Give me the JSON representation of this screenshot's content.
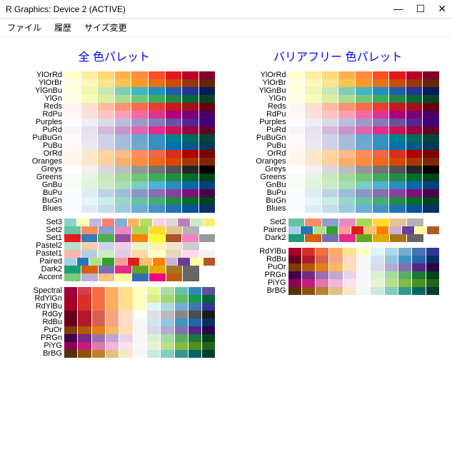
{
  "window": {
    "title": "R Graphics: Device 2 (ACTIVE)"
  },
  "menu": [
    "ファイル",
    "履歴",
    "サイズ変更"
  ],
  "chart_data": {
    "type": "table",
    "left_title": "全 色パレット",
    "right_title": "バリアフリー 色パレット",
    "palettes": {
      "YlOrRd": [
        "#FFFFCC",
        "#FFEDA0",
        "#FED976",
        "#FEB24C",
        "#FD8D3C",
        "#FC4E2A",
        "#E31A1C",
        "#BD0026",
        "#800026"
      ],
      "YlOrBr": [
        "#FFFFE5",
        "#FFF7BC",
        "#FEE391",
        "#FEC44F",
        "#FE9929",
        "#EC7014",
        "#CC4C02",
        "#993404",
        "#662506"
      ],
      "YlGnBu": [
        "#FFFFD9",
        "#EDF8B1",
        "#C7E9B4",
        "#7FCDBB",
        "#41B6C4",
        "#1D91C0",
        "#225EA8",
        "#253494",
        "#081D58"
      ],
      "YlGn": [
        "#FFFFE5",
        "#F7FCB9",
        "#D9F0A3",
        "#ADDD8E",
        "#78C679",
        "#41AB5D",
        "#238443",
        "#006837",
        "#004529"
      ],
      "Reds": [
        "#FFF5F0",
        "#FEE0D2",
        "#FCBBA1",
        "#FC9272",
        "#FB6A4A",
        "#EF3B2C",
        "#CB181D",
        "#A50F15",
        "#67000D"
      ],
      "RdPu": [
        "#FFF7F3",
        "#FDE0DD",
        "#FCC5C0",
        "#FA9FB5",
        "#F768A1",
        "#DD3497",
        "#AE017E",
        "#7A0177",
        "#49006A"
      ],
      "Purples": [
        "#FCFBFD",
        "#EFEDF5",
        "#DADAEB",
        "#BCBDDC",
        "#9E9AC8",
        "#807DBA",
        "#6A51A3",
        "#54278F",
        "#3F007D"
      ],
      "PuRd": [
        "#F7F4F9",
        "#E7E1EF",
        "#D4B9DA",
        "#C994C7",
        "#DF65B0",
        "#E7298A",
        "#CE1256",
        "#980043",
        "#67001F"
      ],
      "PuBuGn": [
        "#FFF7FB",
        "#ECE2F0",
        "#D0D1E6",
        "#A6BDDB",
        "#67A9CF",
        "#3690C0",
        "#02818A",
        "#016C59",
        "#014636"
      ],
      "PuBu": [
        "#FFF7FB",
        "#ECE7F2",
        "#D0D1E6",
        "#A6BDDB",
        "#74A9CF",
        "#3690C0",
        "#0570B0",
        "#045A8D",
        "#023858"
      ],
      "OrRd": [
        "#FFF7EC",
        "#FEE8C8",
        "#FDD49E",
        "#FDBB84",
        "#FC8D59",
        "#EF6548",
        "#D7301F",
        "#B30000",
        "#7F0000"
      ],
      "Oranges": [
        "#FFF5EB",
        "#FEE6CE",
        "#FDD0A2",
        "#FDAE6B",
        "#FD8D3C",
        "#F16913",
        "#D94801",
        "#A63603",
        "#7F2704"
      ],
      "Greys": [
        "#FFFFFF",
        "#F0F0F0",
        "#D9D9D9",
        "#BDBDBD",
        "#969696",
        "#737373",
        "#525252",
        "#252525",
        "#000000"
      ],
      "Greens": [
        "#F7FCF5",
        "#E5F5E0",
        "#C7E9C0",
        "#A1D99B",
        "#74C476",
        "#41AB5D",
        "#238B45",
        "#006D2C",
        "#00441B"
      ],
      "GnBu": [
        "#F7FCF0",
        "#E0F3DB",
        "#CCEBC5",
        "#A8DDB5",
        "#7BCCC4",
        "#4EB3D3",
        "#2B8CBE",
        "#0868AC",
        "#084081"
      ],
      "BuPu": [
        "#F7FCFD",
        "#E0ECF4",
        "#BFD3E6",
        "#9EBCDA",
        "#8C96C6",
        "#8C6BB1",
        "#88419D",
        "#810F7C",
        "#4D004B"
      ],
      "BuGn": [
        "#F7FCFD",
        "#E5F5F9",
        "#CCECE6",
        "#99D8C9",
        "#66C2A4",
        "#41AE76",
        "#238B45",
        "#006D2C",
        "#00441B"
      ],
      "Blues": [
        "#F7FBFF",
        "#DEEBF7",
        "#C6DBEF",
        "#9ECAE1",
        "#6BAED6",
        "#4292C6",
        "#2171B5",
        "#08519C",
        "#08306B"
      ],
      "Set3": [
        "#8DD3C7",
        "#FFFFB3",
        "#BEBADA",
        "#FB8072",
        "#80B1D3",
        "#FDB462",
        "#B3DE69",
        "#FCCDE5",
        "#D9D9D9",
        "#BC80BD",
        "#CCEBC5",
        "#FFED6F"
      ],
      "Set2": [
        "#66C2A5",
        "#FC8D62",
        "#8DA0CB",
        "#E78AC3",
        "#A6D854",
        "#FFD92F",
        "#E5C494",
        "#B3B3B3"
      ],
      "Set1": [
        "#E41A1C",
        "#377EB8",
        "#4DAF4A",
        "#984EA3",
        "#FF7F00",
        "#FFFF33",
        "#A65628",
        "#F781BF",
        "#999999"
      ],
      "Pastel2": [
        "#B3E2CD",
        "#FDCDAC",
        "#CBD5E8",
        "#F4CAE4",
        "#E6F5C9",
        "#FFF2AE",
        "#F1E2CC",
        "#CCCCCC"
      ],
      "Pastel1": [
        "#FBB4AE",
        "#B3CDE3",
        "#CCEBC5",
        "#DECBE4",
        "#FED9A6",
        "#FFFFCC",
        "#E5D8BD",
        "#FDDAEC",
        "#F2F2F2"
      ],
      "Paired": [
        "#A6CEE3",
        "#1F78B4",
        "#B2DF8A",
        "#33A02C",
        "#FB9A99",
        "#E31A1C",
        "#FDBF6F",
        "#FF7F00",
        "#CAB2D6",
        "#6A3D9A",
        "#FFFF99",
        "#B15928"
      ],
      "Dark2": [
        "#1B9E77",
        "#D95F02",
        "#7570B3",
        "#E7298A",
        "#66A61E",
        "#E6AB02",
        "#A6761D",
        "#666666"
      ],
      "Accent": [
        "#7FC97F",
        "#BEAED4",
        "#FDC086",
        "#FFFF99",
        "#386CB0",
        "#F0027F",
        "#BF5B17",
        "#666666"
      ],
      "Spectral": [
        "#9E0142",
        "#D53E4F",
        "#F46D43",
        "#FDAE61",
        "#FEE08B",
        "#FFFFBF",
        "#E6F598",
        "#ABDDA4",
        "#66C2A5",
        "#3288BD",
        "#5E4FA2"
      ],
      "RdYlGn": [
        "#A50026",
        "#D73027",
        "#F46D43",
        "#FDAE61",
        "#FEE08B",
        "#FFFFBF",
        "#D9EF8B",
        "#A6D96A",
        "#66BD63",
        "#1A9850",
        "#006837"
      ],
      "RdYlBu": [
        "#A50026",
        "#D73027",
        "#F46D43",
        "#FDAE61",
        "#FEE090",
        "#FFFFBF",
        "#E0F3F8",
        "#ABD9E9",
        "#74ADD1",
        "#4575B4",
        "#313695"
      ],
      "RdGy": [
        "#67001F",
        "#B2182B",
        "#D6604D",
        "#F4A582",
        "#FDDBC7",
        "#FFFFFF",
        "#E0E0E0",
        "#BABABA",
        "#878787",
        "#4D4D4D",
        "#1A1A1A"
      ],
      "RdBu": [
        "#67001F",
        "#B2182B",
        "#D6604D",
        "#F4A582",
        "#FDDBC7",
        "#F7F7F7",
        "#D1E5F0",
        "#92C5DE",
        "#4393C3",
        "#2166AC",
        "#053061"
      ],
      "PuOr": [
        "#7F3B08",
        "#B35806",
        "#E08214",
        "#FDB863",
        "#FEE0B6",
        "#F7F7F7",
        "#D8DAEB",
        "#B2ABD2",
        "#8073AC",
        "#542788",
        "#2D004B"
      ],
      "PRGn": [
        "#40004B",
        "#762A83",
        "#9970AB",
        "#C2A5CF",
        "#E7D4E8",
        "#F7F7F7",
        "#D9F0D3",
        "#A6DBA0",
        "#5AAE61",
        "#1B7837",
        "#00441B"
      ],
      "PiYG": [
        "#8E0152",
        "#C51B7D",
        "#DE77AE",
        "#F1B6DA",
        "#FDE0EF",
        "#F7F7F7",
        "#E6F5D0",
        "#B8E186",
        "#7FBC41",
        "#4D9221",
        "#276419"
      ],
      "BrBG": [
        "#543005",
        "#8C510A",
        "#BF812D",
        "#DFC27D",
        "#F6E8C3",
        "#F5F5F5",
        "#C7EAE5",
        "#80CDC1",
        "#35978F",
        "#01665E",
        "#003C30"
      ]
    },
    "left_groups": [
      [
        "YlOrRd",
        "YlOrBr",
        "YlGnBu",
        "YlGn",
        "Reds",
        "RdPu",
        "Purples",
        "PuRd",
        "PuBuGn",
        "PuBu",
        "OrRd",
        "Oranges",
        "Greys",
        "Greens",
        "GnBu",
        "BuPu",
        "BuGn",
        "Blues"
      ],
      [
        "Set3",
        "Set2",
        "Set1",
        "Pastel2",
        "Pastel1",
        "Paired",
        "Dark2",
        "Accent"
      ],
      [
        "Spectral",
        "RdYlGn",
        "RdYlBu",
        "RdGy",
        "RdBu",
        "PuOr",
        "PRGn",
        "PiYG",
        "BrBG"
      ]
    ],
    "right_groups": [
      [
        "YlOrRd",
        "YlOrBr",
        "YlGnBu",
        "YlGn",
        "Reds",
        "RdPu",
        "Purples",
        "PuRd",
        "PuBuGn",
        "PuBu",
        "OrRd",
        "Oranges",
        "Greys",
        "Greens",
        "GnBu",
        "BuPu",
        "BuGn",
        "Blues"
      ],
      [
        "Set2",
        "Paired",
        "Dark2"
      ],
      [
        "RdYlBu",
        "RdBu",
        "PuOr",
        "PRGn",
        "PiYG",
        "BrBG"
      ]
    ]
  }
}
